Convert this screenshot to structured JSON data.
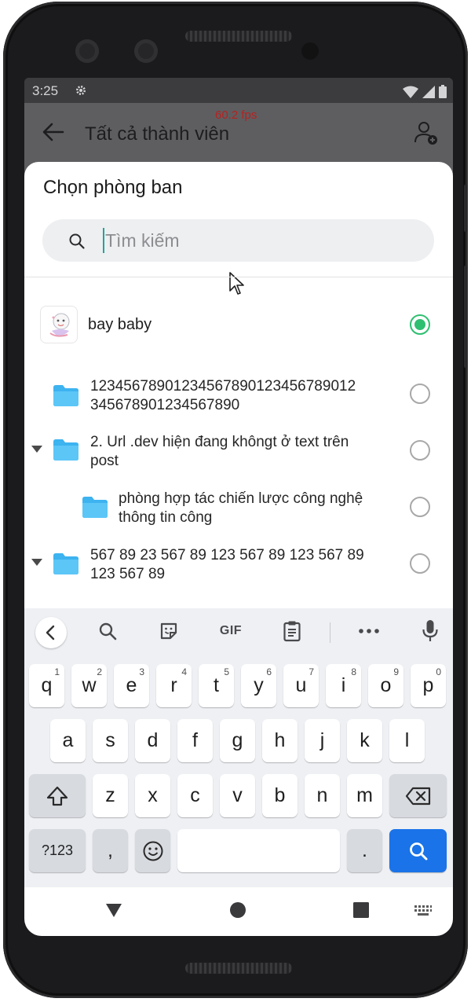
{
  "status_bar": {
    "time": "3:25"
  },
  "app_bar": {
    "title": "Tất cả thành viên",
    "fps_overlay": "60.2 fps"
  },
  "sheet": {
    "title": "Chọn phòng ban",
    "search": {
      "placeholder": "Tìm kiếm",
      "value": ""
    },
    "organization": {
      "name": "bay baby",
      "selected": true
    },
    "departments": [
      {
        "label_line1": "12345678901234567890123456789012",
        "label_line2": "345678901234567890",
        "expandable": false,
        "level": 0
      },
      {
        "label_line1": "2. Url .dev hiện đang khôngt ở text trên",
        "label_line2": "post",
        "expandable": true,
        "level": 0
      },
      {
        "label_line1": "phòng hợp tác chiến lược công nghệ",
        "label_line2": "thông tin công",
        "expandable": false,
        "level": 1
      },
      {
        "label_line1": "567 89 23 567 89 123 567 89 123 567 89",
        "label_line2": "123 567 89",
        "expandable": true,
        "level": 0
      }
    ]
  },
  "keyboard": {
    "toolbar": {
      "gif": "GIF"
    },
    "row1": [
      {
        "k": "q",
        "n": "1"
      },
      {
        "k": "w",
        "n": "2"
      },
      {
        "k": "e",
        "n": "3"
      },
      {
        "k": "r",
        "n": "4"
      },
      {
        "k": "t",
        "n": "5"
      },
      {
        "k": "y",
        "n": "6"
      },
      {
        "k": "u",
        "n": "7"
      },
      {
        "k": "i",
        "n": "8"
      },
      {
        "k": "o",
        "n": "9"
      },
      {
        "k": "p",
        "n": "0"
      }
    ],
    "row2": [
      "a",
      "s",
      "d",
      "f",
      "g",
      "h",
      "j",
      "k",
      "l"
    ],
    "row3": [
      "z",
      "x",
      "c",
      "v",
      "b",
      "n",
      "m"
    ],
    "symbols_label": "?123",
    "comma": ",",
    "period": "."
  },
  "colors": {
    "accent": "#2fbf71",
    "folder": "#3db3f0",
    "search_key": "#1a73e8"
  }
}
